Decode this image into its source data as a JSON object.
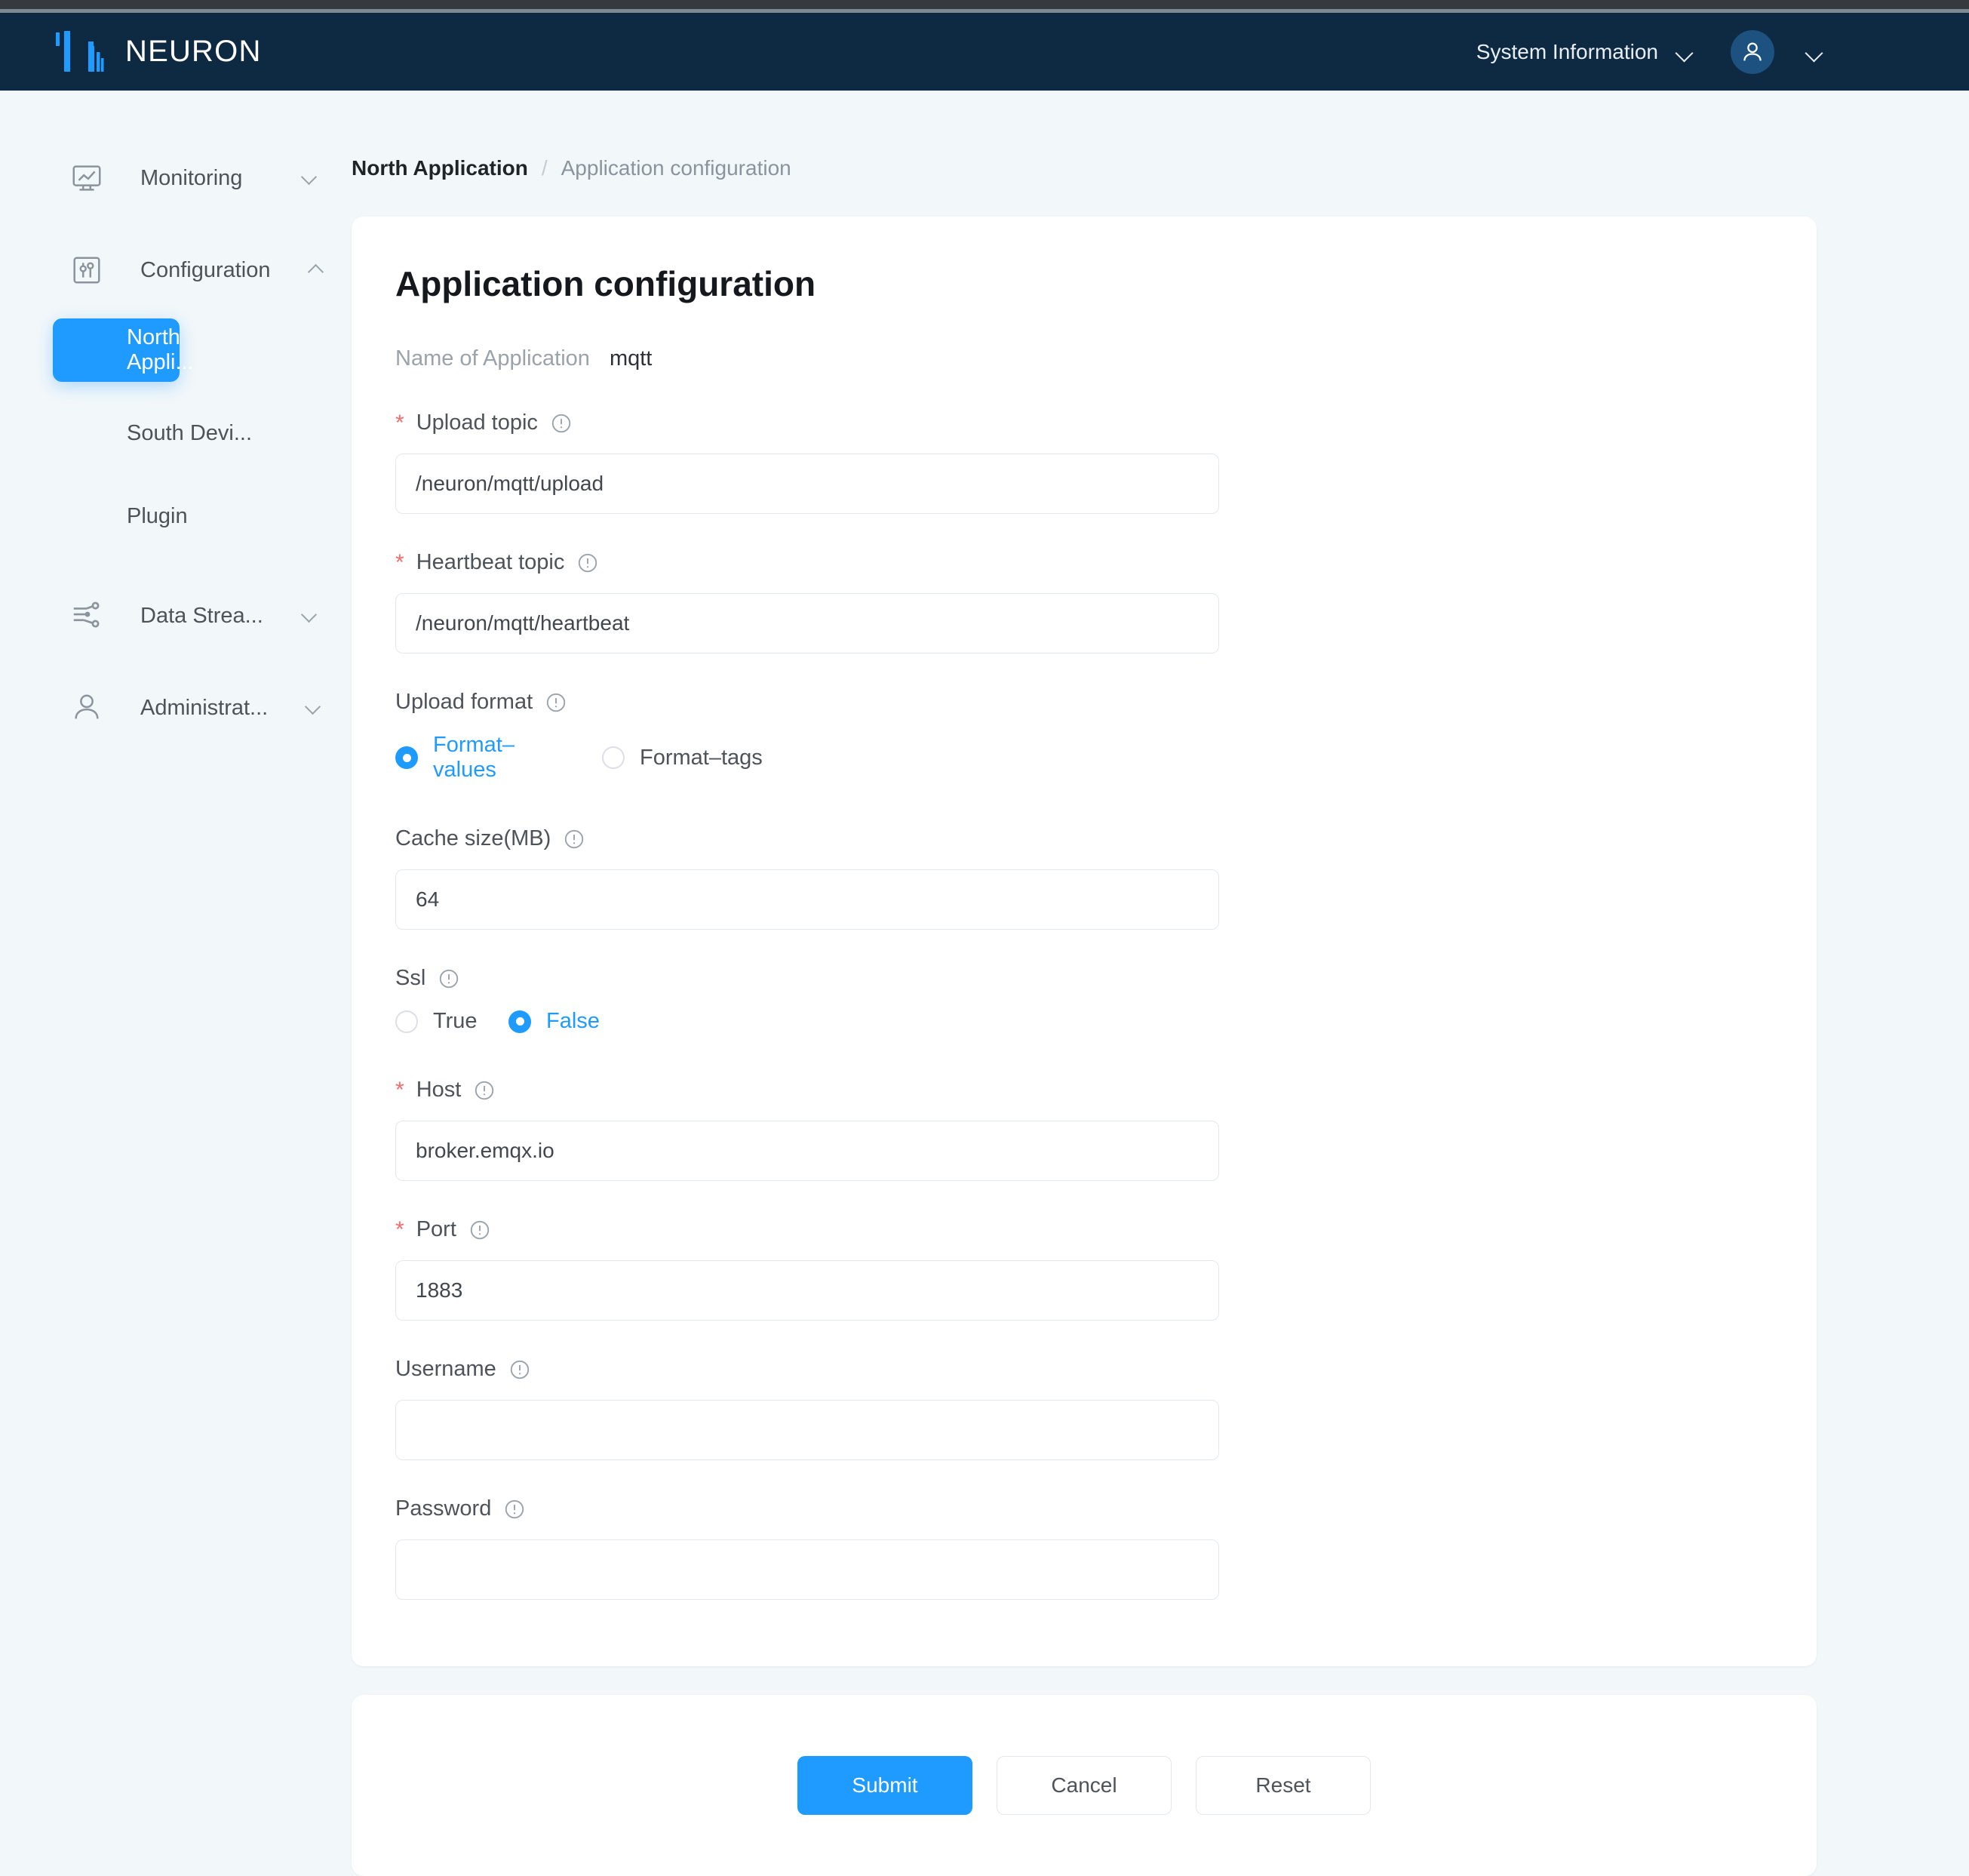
{
  "os": {
    "strip": ""
  },
  "header": {
    "brand": "NEURON",
    "system_info_label": "System Information",
    "accent": "#1f9bff",
    "background": "#0e2a42"
  },
  "sidebar": {
    "groups": [
      {
        "label": "Monitoring",
        "icon": "monitor-chart-icon",
        "expanded": false,
        "caret": "down"
      },
      {
        "label": "Configuration",
        "icon": "sliders-icon",
        "expanded": true,
        "caret": "up"
      }
    ],
    "sub_items": [
      {
        "label": "North Appli...",
        "active": true
      },
      {
        "label": "South Devi...",
        "active": false
      },
      {
        "label": "Plugin",
        "active": false
      }
    ],
    "groups_bottom": [
      {
        "label": "Data Strea...",
        "icon": "data-stream-icon",
        "caret": "down"
      },
      {
        "label": "Administrat...",
        "icon": "user-icon",
        "caret": "down"
      }
    ]
  },
  "breadcrumb": {
    "parent": "North Application",
    "separator": "/",
    "current": "Application configuration"
  },
  "form": {
    "title": "Application configuration",
    "name_label": "Name of Application",
    "name_value": "mqtt",
    "fields": [
      {
        "label": "Upload topic",
        "required": true,
        "value": "/neuron/mqtt/upload",
        "placeholder": ""
      },
      {
        "label": "Heartbeat topic",
        "required": true,
        "value": "/neuron/mqtt/heartbeat",
        "placeholder": ""
      }
    ],
    "upload_format": {
      "label": "Upload format",
      "options": [
        {
          "label": "Format–values",
          "selected": true
        },
        {
          "label": "Format–tags",
          "selected": false
        }
      ]
    },
    "cache_size": {
      "label": "Cache size(MB)",
      "required": false,
      "value": "64"
    },
    "ssl": {
      "label": "Ssl",
      "options": [
        {
          "label": "True",
          "selected": false
        },
        {
          "label": "False",
          "selected": true
        }
      ]
    },
    "host": {
      "label": "Host",
      "required": true,
      "value": "broker.emqx.io"
    },
    "port": {
      "label": "Port",
      "required": true,
      "value": "1883"
    },
    "username": {
      "label": "Username",
      "required": false,
      "value": "",
      "placeholder": ""
    },
    "password": {
      "label": "Password",
      "required": false,
      "value": "",
      "placeholder": ""
    },
    "required_marker": "*"
  },
  "footer": {
    "submit_label": "Submit",
    "cancel_label": "Cancel",
    "reset_label": "Reset"
  }
}
